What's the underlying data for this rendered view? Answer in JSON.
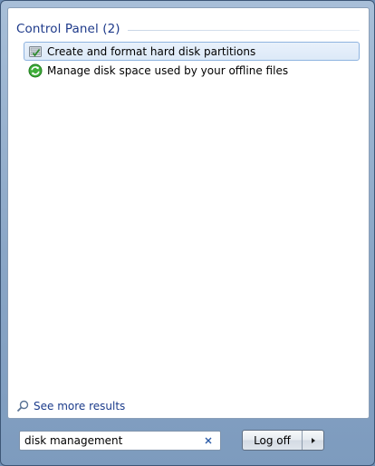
{
  "results_pane": {
    "group_title": "Control Panel (2)",
    "items": [
      {
        "label": "Create and format hard disk partitions",
        "icon": "disk-management-icon",
        "selected": true
      },
      {
        "label": "Manage disk space used by your offline files",
        "icon": "sync-center-icon",
        "selected": false
      }
    ],
    "see_more": "See more results"
  },
  "search": {
    "value": "disk management",
    "clear_icon": "clear-search-icon"
  },
  "power": {
    "logoff_label": "Log off",
    "arrow_icon": "right-arrow-icon"
  },
  "colors": {
    "header_blue": "#1e3a8a",
    "selection_border": "#8fb4e0",
    "frame_blue": "#8aa6c6"
  }
}
